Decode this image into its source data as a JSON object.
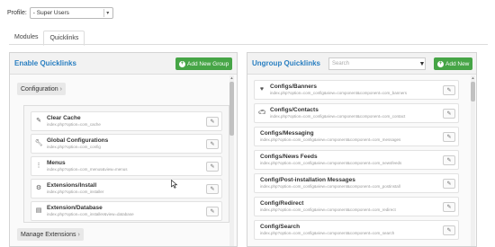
{
  "profile": {
    "label": "Profile:",
    "selected": "- Super Users"
  },
  "tabs": [
    {
      "label": "Modules"
    },
    {
      "label": "Quicklinks"
    }
  ],
  "enable_panel": {
    "title": "Enable Quicklinks",
    "add_group_label": "Add New Group",
    "groups": [
      {
        "label": "Configuration"
      },
      {
        "label": "Manage Extensions"
      }
    ],
    "chevron": "›",
    "items": [
      {
        "title": "Clear Cache",
        "url": "index.php?option=com_cache",
        "icon": "broom-icon"
      },
      {
        "title": "Global Configurations",
        "url": "index.php?option=com_config",
        "icon": "wrench-icon"
      },
      {
        "title": "Menus",
        "url": "index.php?option=com_menus&view=menus",
        "icon": "menu-icon"
      },
      {
        "title": "Extensions/Install",
        "url": "index.php?option=com_installer",
        "icon": "gear-icon"
      },
      {
        "title": "Extension/Database",
        "url": "index.php?option=com_installer&view=database",
        "icon": "database-icon"
      }
    ]
  },
  "ungroup_panel": {
    "title": "Ungroup Quicklinks",
    "search_placeholder": "Search",
    "add_new_label": "Add New",
    "items": [
      {
        "title": "Configs/Banners",
        "url": "index.php?option=com_config&view=component&component=com_banners",
        "icon": "heart-icon"
      },
      {
        "title": "Configs/Contacts",
        "url": "index.php?option=com_config&view=component&component=com_contact",
        "icon": "car-icon"
      },
      {
        "title": "Configs/Messaging",
        "url": "index.php?option=com_config&view=component&component=com_messages",
        "icon": ""
      },
      {
        "title": "Configs/News Feeds",
        "url": "index.php?option=com_config&view=component&component=com_newsfeeds",
        "icon": ""
      },
      {
        "title": "Config/Post-installation Messages",
        "url": "index.php?option=com_config&view=component&component=com_postinstall",
        "icon": ""
      },
      {
        "title": "Config/Redirect",
        "url": "index.php?option=com_config&view=component&component=com_redirect",
        "icon": ""
      },
      {
        "title": "Config/Search",
        "url": "index.php?option=com_config&view=component&component=com_search",
        "icon": ""
      }
    ]
  },
  "colors": {
    "accent": "#2a7fc1",
    "success": "#46a546"
  }
}
